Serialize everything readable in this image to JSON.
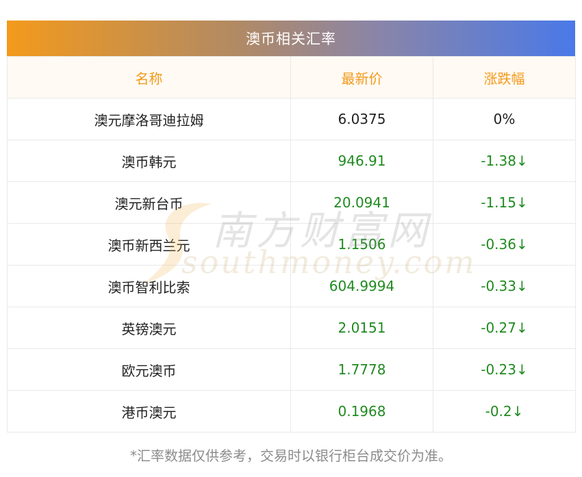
{
  "table": {
    "title": "澳币相关汇率",
    "headers": [
      "名称",
      "最新价",
      "涨跌幅"
    ],
    "rows": [
      {
        "name": "澳元摩洛哥迪拉姆",
        "price": "6.0375",
        "change": "0%",
        "trend": "neutral"
      },
      {
        "name": "澳币韩元",
        "price": "946.91",
        "change": "-1.38↓",
        "trend": "down"
      },
      {
        "name": "澳元新台币",
        "price": "20.0941",
        "change": "-1.15↓",
        "trend": "down"
      },
      {
        "name": "澳币新西兰元",
        "price": "1.1506",
        "change": "-0.36↓",
        "trend": "down"
      },
      {
        "name": "澳币智利比索",
        "price": "604.9994",
        "change": "-0.33↓",
        "trend": "down"
      },
      {
        "name": "英镑澳元",
        "price": "2.0151",
        "change": "-0.27↓",
        "trend": "down"
      },
      {
        "name": "欧元澳币",
        "price": "1.7778",
        "change": "-0.23↓",
        "trend": "down"
      },
      {
        "name": "港币澳元",
        "price": "0.1968",
        "change": "-0.2↓",
        "trend": "down"
      }
    ]
  },
  "note": "*汇率数据仅供参考，交易时以银行柜台成交价为准。",
  "watermark": {
    "cn": "南方财富网",
    "en": "southmoney.com"
  },
  "colors": {
    "header_text": "#f39a1c",
    "down": "#1f8a1f",
    "title_gradient_start": "#f39a1c",
    "title_gradient_end": "#4a79e8"
  }
}
